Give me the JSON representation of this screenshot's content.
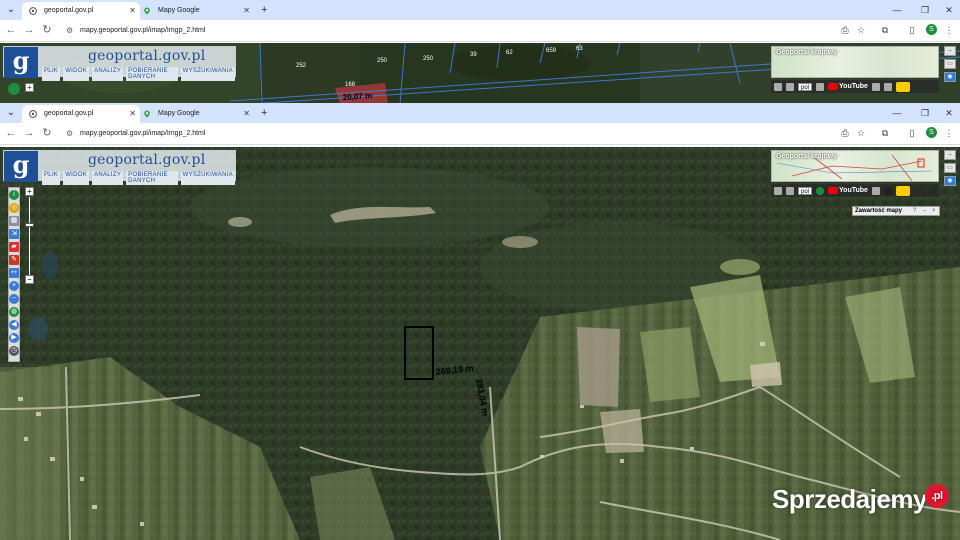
{
  "window_top": {
    "tabs": [
      {
        "label": "geoportal.gov.pl",
        "icon": "geoportal-favicon-icon",
        "active": true
      },
      {
        "label": "Mapy Google",
        "icon": "google-maps-pin-icon",
        "active": false
      }
    ],
    "url": "mapy.geoportal.gov.pl/imap/Imgp_2.html",
    "avatar_letter": "S",
    "map": {
      "parcel_labels": [
        "252",
        "250",
        "250",
        "39",
        "62",
        "659",
        "63",
        "168"
      ],
      "measure_label": "20,07 m"
    }
  },
  "window_main": {
    "tabs": [
      {
        "label": "geoportal.gov.pl",
        "icon": "geoportal-favicon-icon",
        "active": true
      },
      {
        "label": "Mapy Google",
        "icon": "google-maps-pin-icon",
        "active": false
      }
    ],
    "url": "mapy.geoportal.gov.pl/imap/Imgp_2.html",
    "avatar_letter": "S",
    "map": {
      "measure_horizontal": "269,19 m",
      "measure_vertical": "393,04 m"
    }
  },
  "geoportal": {
    "logo_letter": "g",
    "logo_text": "geoportal.gov.pl",
    "menu": [
      "PLIK",
      "WIDOK",
      "ANALIZY",
      "POBIERANIE DANYCH",
      "WYSZUKIWANIA"
    ],
    "overview_title": "Geoportal krajowy",
    "language": "pol",
    "youtube_label": "YouTube",
    "contents_panel_title": "Zawartość mapy",
    "contents_panel_buttons": [
      "?",
      "–",
      "×"
    ]
  },
  "watermark": {
    "text": "Sprzedajemy",
    "badge": ".pl"
  },
  "colors": {
    "tabstrip": "#d3e3fd",
    "geoportal_blue": "#1f4f97",
    "parcel_outline": "#000000",
    "watermark_badge": "#e3142d"
  }
}
